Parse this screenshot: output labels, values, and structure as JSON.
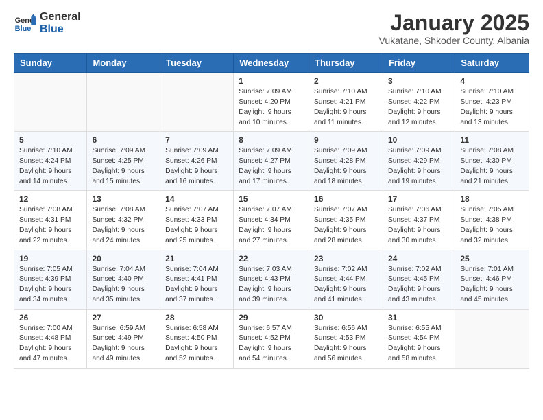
{
  "header": {
    "logo_general": "General",
    "logo_blue": "Blue",
    "month_title": "January 2025",
    "subtitle": "Vukatane, Shkoder County, Albania"
  },
  "weekdays": [
    "Sunday",
    "Monday",
    "Tuesday",
    "Wednesday",
    "Thursday",
    "Friday",
    "Saturday"
  ],
  "weeks": [
    [
      {
        "day": "",
        "info": ""
      },
      {
        "day": "",
        "info": ""
      },
      {
        "day": "",
        "info": ""
      },
      {
        "day": "1",
        "info": "Sunrise: 7:09 AM\nSunset: 4:20 PM\nDaylight: 9 hours\nand 10 minutes."
      },
      {
        "day": "2",
        "info": "Sunrise: 7:10 AM\nSunset: 4:21 PM\nDaylight: 9 hours\nand 11 minutes."
      },
      {
        "day": "3",
        "info": "Sunrise: 7:10 AM\nSunset: 4:22 PM\nDaylight: 9 hours\nand 12 minutes."
      },
      {
        "day": "4",
        "info": "Sunrise: 7:10 AM\nSunset: 4:23 PM\nDaylight: 9 hours\nand 13 minutes."
      }
    ],
    [
      {
        "day": "5",
        "info": "Sunrise: 7:10 AM\nSunset: 4:24 PM\nDaylight: 9 hours\nand 14 minutes."
      },
      {
        "day": "6",
        "info": "Sunrise: 7:09 AM\nSunset: 4:25 PM\nDaylight: 9 hours\nand 15 minutes."
      },
      {
        "day": "7",
        "info": "Sunrise: 7:09 AM\nSunset: 4:26 PM\nDaylight: 9 hours\nand 16 minutes."
      },
      {
        "day": "8",
        "info": "Sunrise: 7:09 AM\nSunset: 4:27 PM\nDaylight: 9 hours\nand 17 minutes."
      },
      {
        "day": "9",
        "info": "Sunrise: 7:09 AM\nSunset: 4:28 PM\nDaylight: 9 hours\nand 18 minutes."
      },
      {
        "day": "10",
        "info": "Sunrise: 7:09 AM\nSunset: 4:29 PM\nDaylight: 9 hours\nand 19 minutes."
      },
      {
        "day": "11",
        "info": "Sunrise: 7:08 AM\nSunset: 4:30 PM\nDaylight: 9 hours\nand 21 minutes."
      }
    ],
    [
      {
        "day": "12",
        "info": "Sunrise: 7:08 AM\nSunset: 4:31 PM\nDaylight: 9 hours\nand 22 minutes."
      },
      {
        "day": "13",
        "info": "Sunrise: 7:08 AM\nSunset: 4:32 PM\nDaylight: 9 hours\nand 24 minutes."
      },
      {
        "day": "14",
        "info": "Sunrise: 7:07 AM\nSunset: 4:33 PM\nDaylight: 9 hours\nand 25 minutes."
      },
      {
        "day": "15",
        "info": "Sunrise: 7:07 AM\nSunset: 4:34 PM\nDaylight: 9 hours\nand 27 minutes."
      },
      {
        "day": "16",
        "info": "Sunrise: 7:07 AM\nSunset: 4:35 PM\nDaylight: 9 hours\nand 28 minutes."
      },
      {
        "day": "17",
        "info": "Sunrise: 7:06 AM\nSunset: 4:37 PM\nDaylight: 9 hours\nand 30 minutes."
      },
      {
        "day": "18",
        "info": "Sunrise: 7:05 AM\nSunset: 4:38 PM\nDaylight: 9 hours\nand 32 minutes."
      }
    ],
    [
      {
        "day": "19",
        "info": "Sunrise: 7:05 AM\nSunset: 4:39 PM\nDaylight: 9 hours\nand 34 minutes."
      },
      {
        "day": "20",
        "info": "Sunrise: 7:04 AM\nSunset: 4:40 PM\nDaylight: 9 hours\nand 35 minutes."
      },
      {
        "day": "21",
        "info": "Sunrise: 7:04 AM\nSunset: 4:41 PM\nDaylight: 9 hours\nand 37 minutes."
      },
      {
        "day": "22",
        "info": "Sunrise: 7:03 AM\nSunset: 4:43 PM\nDaylight: 9 hours\nand 39 minutes."
      },
      {
        "day": "23",
        "info": "Sunrise: 7:02 AM\nSunset: 4:44 PM\nDaylight: 9 hours\nand 41 minutes."
      },
      {
        "day": "24",
        "info": "Sunrise: 7:02 AM\nSunset: 4:45 PM\nDaylight: 9 hours\nand 43 minutes."
      },
      {
        "day": "25",
        "info": "Sunrise: 7:01 AM\nSunset: 4:46 PM\nDaylight: 9 hours\nand 45 minutes."
      }
    ],
    [
      {
        "day": "26",
        "info": "Sunrise: 7:00 AM\nSunset: 4:48 PM\nDaylight: 9 hours\nand 47 minutes."
      },
      {
        "day": "27",
        "info": "Sunrise: 6:59 AM\nSunset: 4:49 PM\nDaylight: 9 hours\nand 49 minutes."
      },
      {
        "day": "28",
        "info": "Sunrise: 6:58 AM\nSunset: 4:50 PM\nDaylight: 9 hours\nand 52 minutes."
      },
      {
        "day": "29",
        "info": "Sunrise: 6:57 AM\nSunset: 4:52 PM\nDaylight: 9 hours\nand 54 minutes."
      },
      {
        "day": "30",
        "info": "Sunrise: 6:56 AM\nSunset: 4:53 PM\nDaylight: 9 hours\nand 56 minutes."
      },
      {
        "day": "31",
        "info": "Sunrise: 6:55 AM\nSunset: 4:54 PM\nDaylight: 9 hours\nand 58 minutes."
      },
      {
        "day": "",
        "info": ""
      }
    ]
  ]
}
